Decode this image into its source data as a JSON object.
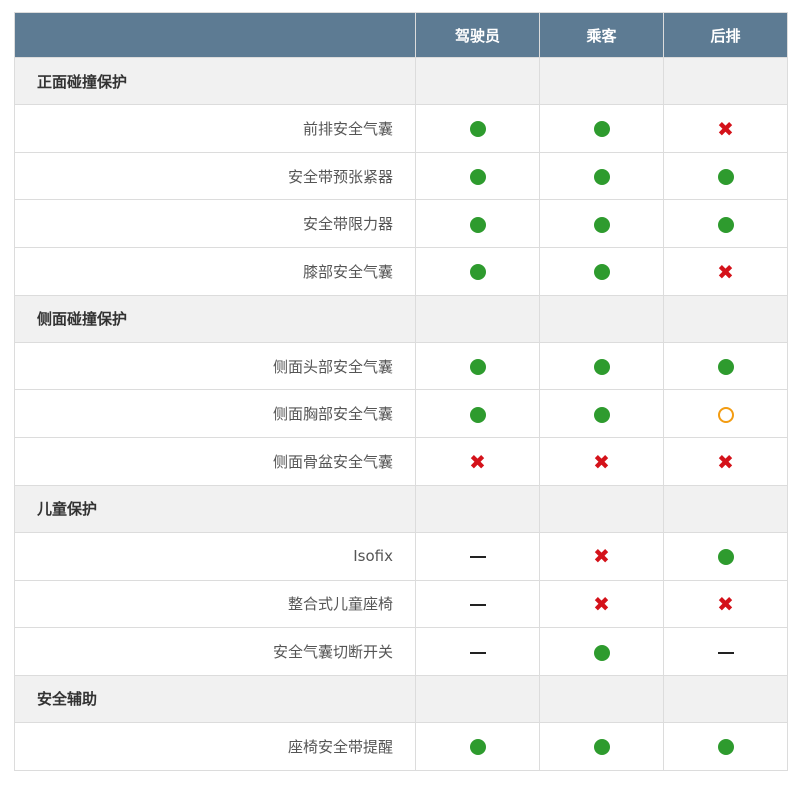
{
  "header": {
    "columns": [
      "驾驶员",
      "乘客",
      "后排"
    ]
  },
  "sections": [
    {
      "title": "正面碰撞保护",
      "items": [
        {
          "label": "前排安全气囊",
          "marks": [
            "dot",
            "dot",
            "cross"
          ]
        },
        {
          "label": "安全带预张紧器",
          "marks": [
            "dot",
            "dot",
            "dot"
          ]
        },
        {
          "label": "安全带限力器",
          "marks": [
            "dot",
            "dot",
            "dot"
          ]
        },
        {
          "label": "膝部安全气囊",
          "marks": [
            "dot",
            "dot",
            "cross"
          ]
        }
      ]
    },
    {
      "title": "侧面碰撞保护",
      "items": [
        {
          "label": "侧面头部安全气囊",
          "marks": [
            "dot",
            "dot",
            "dot"
          ]
        },
        {
          "label": "侧面胸部安全气囊",
          "marks": [
            "dot",
            "dot",
            "ring"
          ]
        },
        {
          "label": "侧面骨盆安全气囊",
          "marks": [
            "cross",
            "cross",
            "cross"
          ]
        }
      ]
    },
    {
      "title": "儿童保护",
      "items": [
        {
          "label": "Isofix",
          "marks": [
            "dash",
            "cross",
            "dot"
          ]
        },
        {
          "label": "整合式儿童座椅",
          "marks": [
            "dash",
            "cross",
            "cross"
          ]
        },
        {
          "label": "安全气囊切断开关",
          "marks": [
            "dash",
            "dot",
            "dash"
          ]
        }
      ]
    },
    {
      "title": "安全辅助",
      "items": [
        {
          "label": "座椅安全带提醒",
          "marks": [
            "dot",
            "dot",
            "dot"
          ]
        }
      ]
    }
  ],
  "legend_icons": {
    "dot": "green-dot-icon",
    "ring": "orange-ring-icon",
    "cross": "red-cross-icon",
    "dash": "dash-icon"
  },
  "colors": {
    "header_bg": "#5d7b93",
    "section_bg": "#f1f1f1",
    "dot": "#2e9b2e",
    "ring": "#f39c12",
    "cross": "#d4121a"
  }
}
